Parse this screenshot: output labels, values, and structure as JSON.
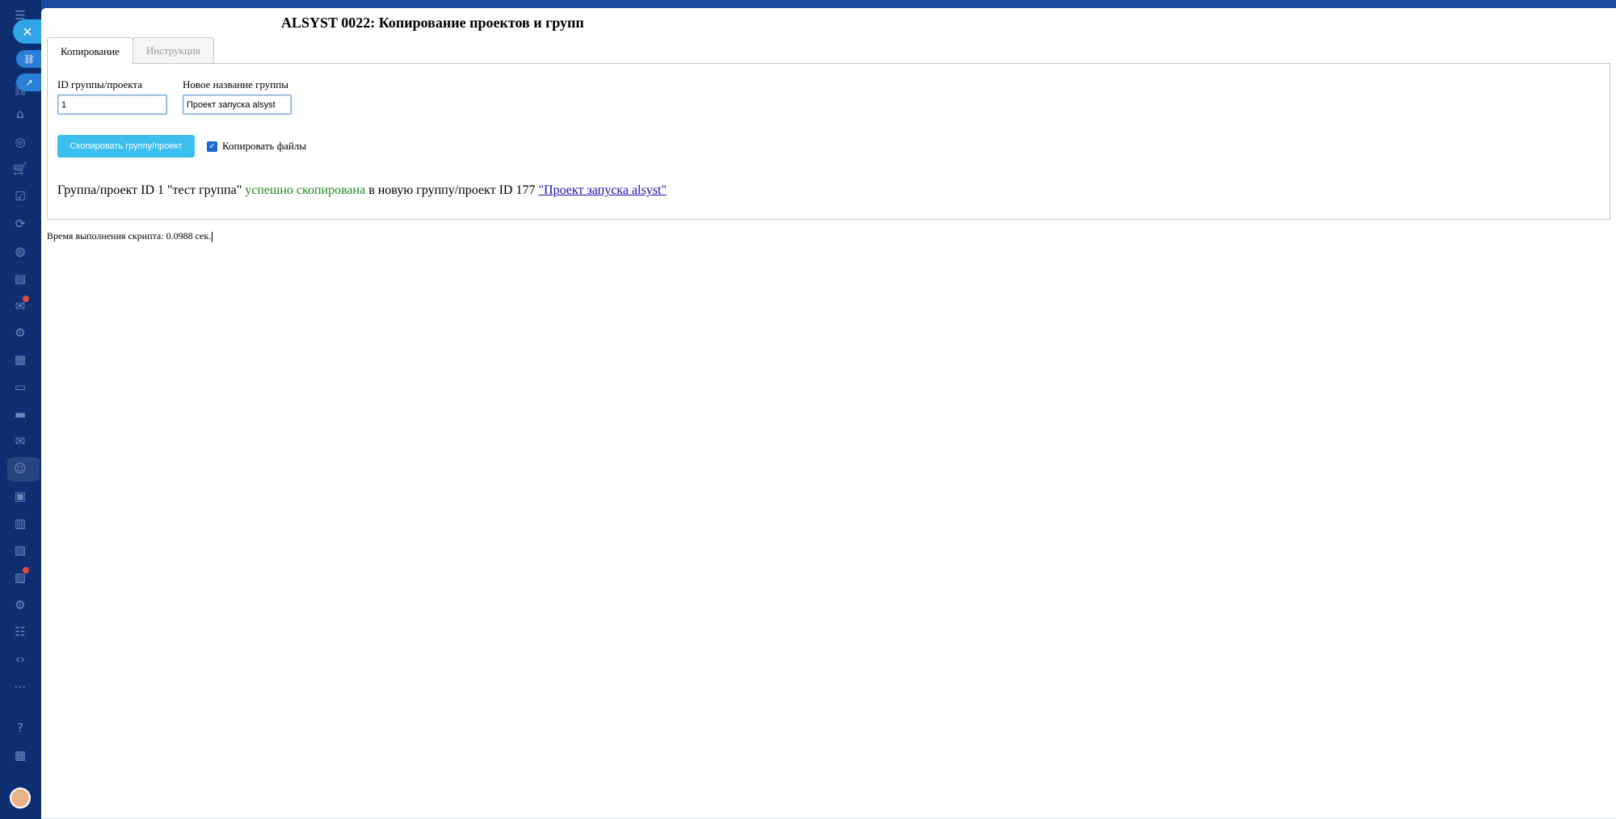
{
  "window": {
    "title": "ALSYST 0022: Копирование проектов и групп"
  },
  "tabs": [
    {
      "label": "Копирование",
      "active": true
    },
    {
      "label": "Инструкция",
      "active": false
    }
  ],
  "form": {
    "group_id": {
      "label": "ID группы/проекта",
      "value": "1"
    },
    "new_name": {
      "label": "Новое название группы",
      "value": "Проект запуска alsyst"
    },
    "copy_button": "Скопировать группу/проект",
    "copy_files": {
      "label": "Копировать файлы",
      "checked": true
    }
  },
  "result": {
    "prefix": "Группа/проект ID 1 \"тест группа\" ",
    "status": "успешно скопирована",
    "middle": " в новую группу/проект ID 177 ",
    "link": "\"Проект запуска alsyst\""
  },
  "footer": {
    "exec_time": "Время выполнения скрипта: 0.0988 сек."
  },
  "sidebar": {
    "icons": [
      "menu-icon",
      "link-icon",
      "open-external-icon",
      "bank-icon",
      "target-icon",
      "cart-icon",
      "checklist-icon",
      "flow-icon",
      "ds-badge-icon",
      "document-icon",
      "chat-icon",
      "settings-icon",
      "calendar-icon",
      "file-icon",
      "card-icon",
      "mail-icon",
      "contacts-icon",
      "news-icon",
      "chart-icon",
      "picture-icon",
      "inbox-icon",
      "gear-icon",
      "group-icon",
      "code-icon",
      "more-icon",
      "help-icon",
      "apps-icon"
    ]
  },
  "colors": {
    "accent": "#3bbfef",
    "success": "#1e8a1e",
    "link": "#1a0dab",
    "sidebar": "#0d2f72"
  }
}
